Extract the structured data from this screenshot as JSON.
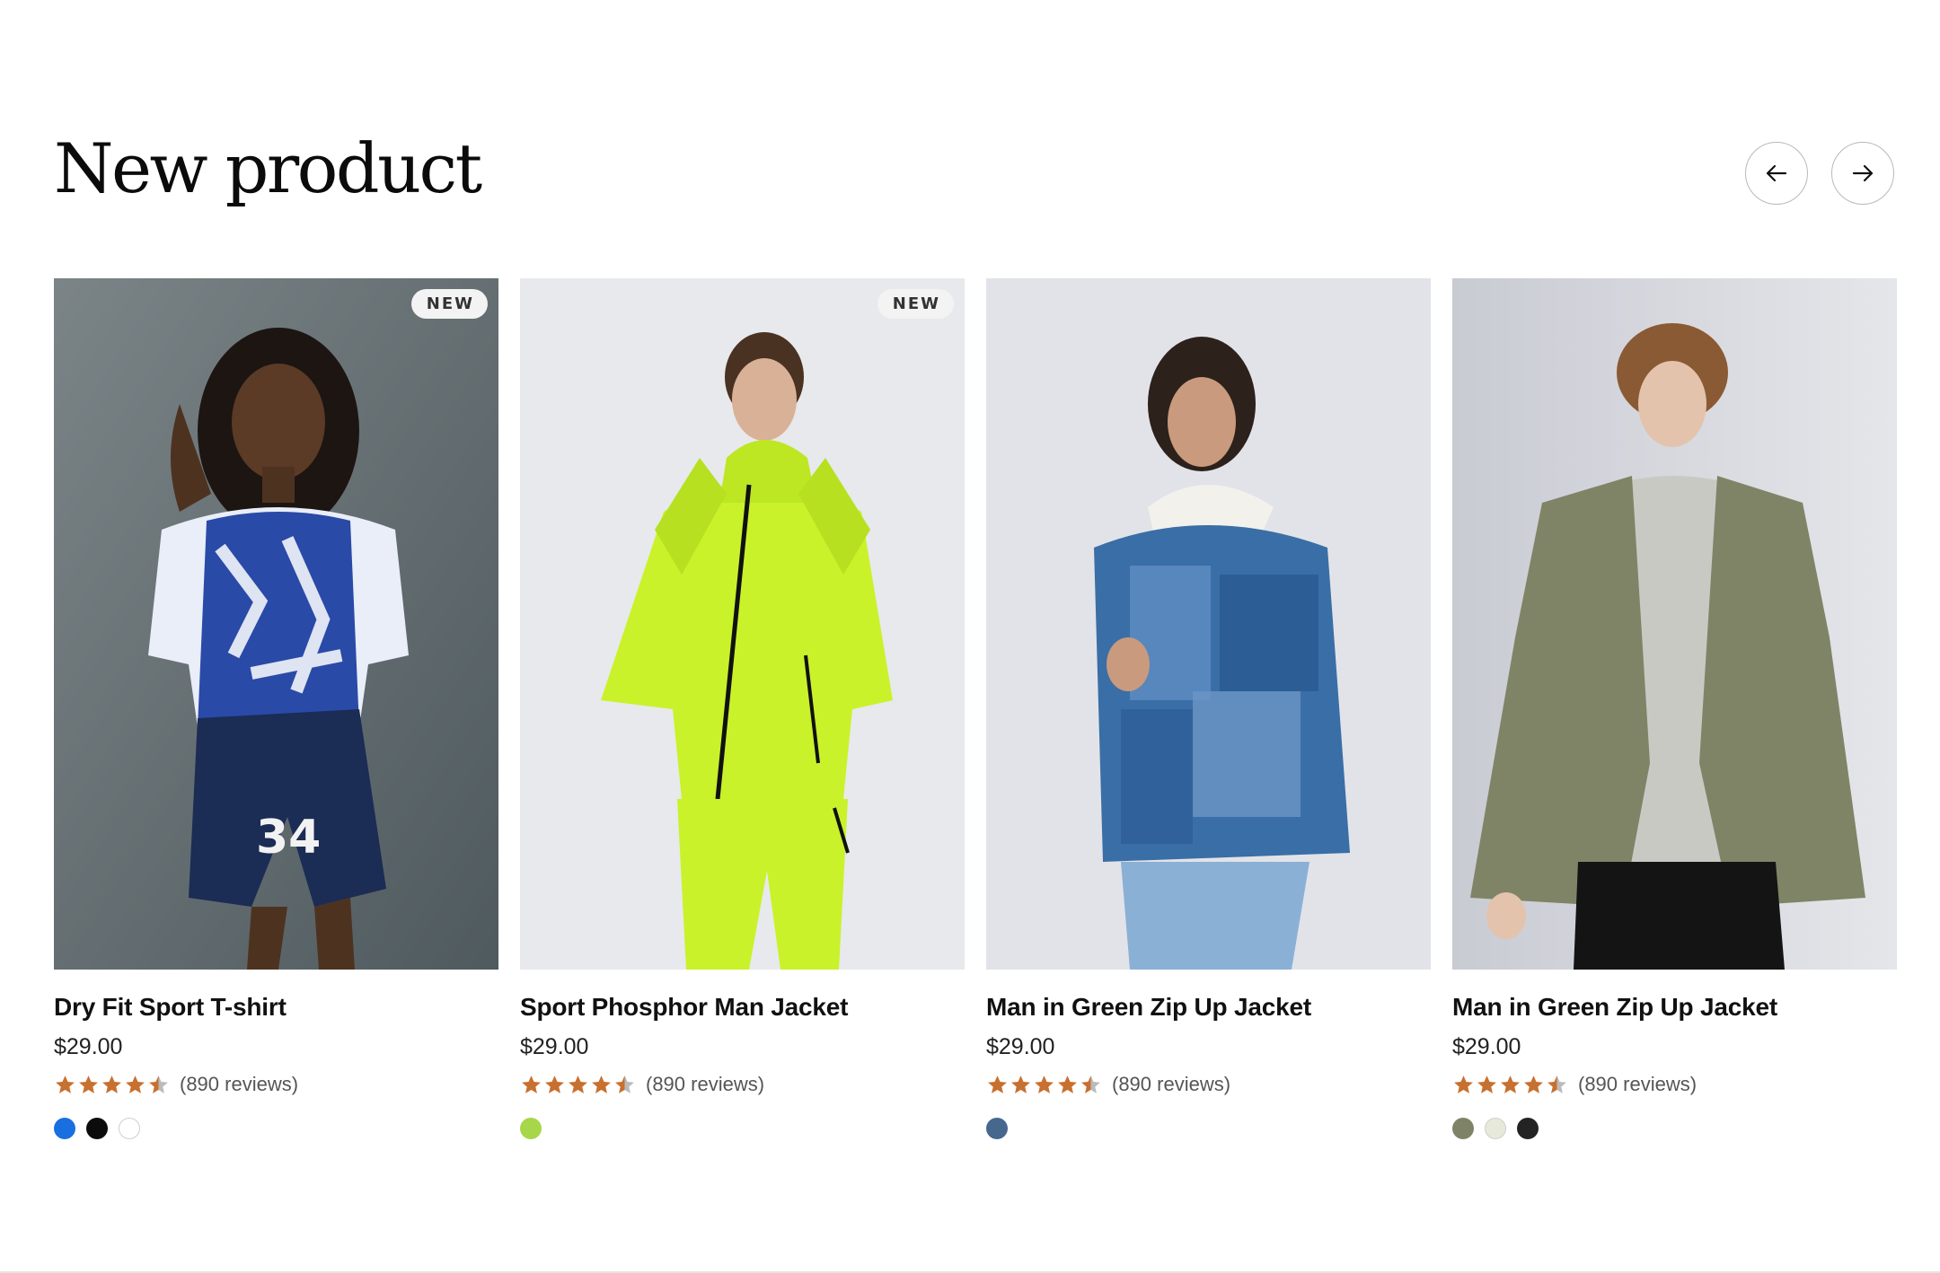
{
  "section": {
    "title": "New product"
  },
  "navigation": {
    "prev_icon": "arrow-left-icon",
    "next_icon": "arrow-right-icon"
  },
  "colors": {
    "star": "#C8702F",
    "star_empty": "#BBBBBB"
  },
  "products": [
    {
      "name": "Dry Fit Sport T-shirt",
      "price": "$29.00",
      "rating": 4.5,
      "reviews": "(890 reviews)",
      "badge": "NEW",
      "swatches": [
        "#1A6FE0",
        "#0C0C0C",
        "#FFFFFF"
      ]
    },
    {
      "name": "Sport Phosphor Man Jacket",
      "price": "$29.00",
      "rating": 4.5,
      "reviews": "(890 reviews)",
      "badge": "NEW",
      "swatches": [
        "#A6D64A"
      ]
    },
    {
      "name": "Man in Green Zip Up Jacket",
      "price": "$29.00",
      "rating": 4.5,
      "reviews": "(890 reviews)",
      "badge": "",
      "swatches": [
        "#46688F"
      ]
    },
    {
      "name": "Man in Green Zip Up Jacket",
      "price": "$29.00",
      "rating": 4.5,
      "reviews": "(890 reviews)",
      "badge": "",
      "swatches": [
        "#7E8368",
        "#E7EAD8",
        "#232323"
      ]
    }
  ]
}
